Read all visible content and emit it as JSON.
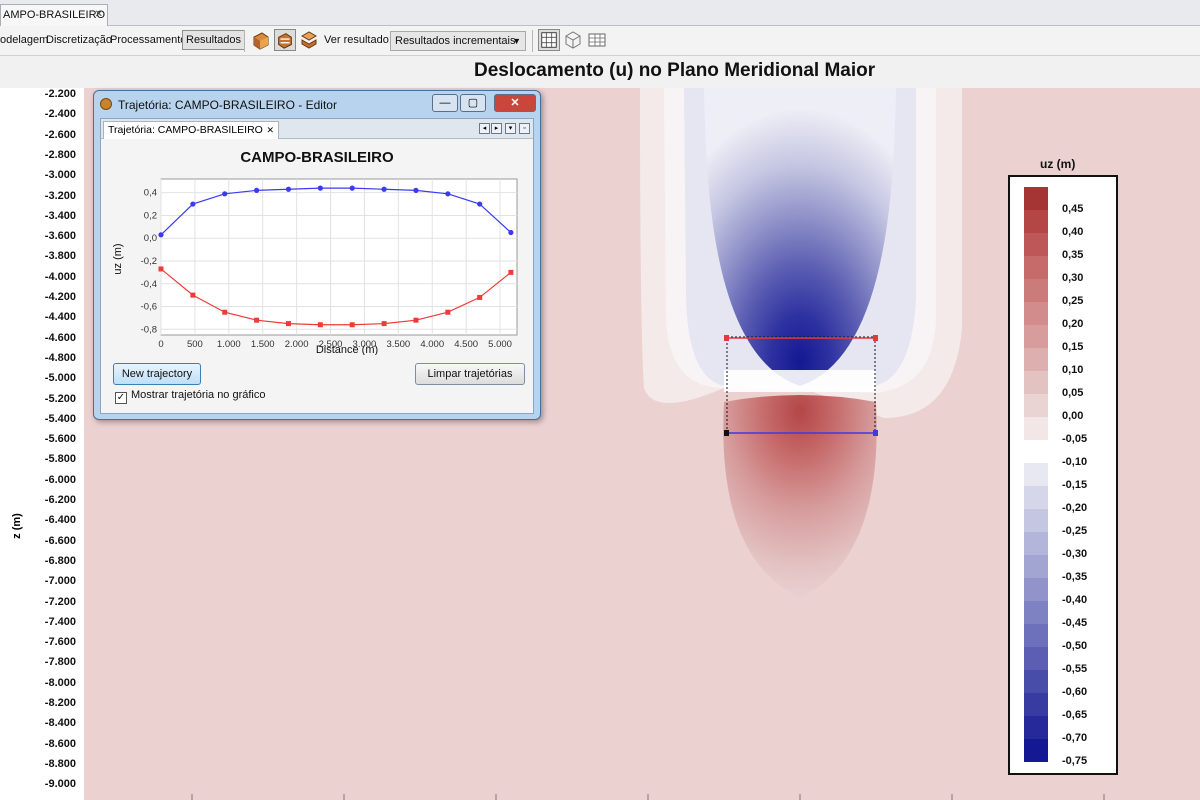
{
  "tab": {
    "label": "AMPO-BRASILEIRO"
  },
  "toolbar": {
    "modelagem": "odelagem",
    "discretizacao": "Discretização",
    "processamento": "Processamento",
    "resultados": "Resultados",
    "ver_resultado_label": "Ver resultado:",
    "ver_resultado_value": "Resultados incrementais"
  },
  "plot": {
    "title": "Deslocamento (u) no Plano Meridional Maior",
    "y_axis_label": "z (m)",
    "y_ticks": [
      "-2.200",
      "-2.400",
      "-2.600",
      "-2.800",
      "-3.000",
      "-3.200",
      "-3.400",
      "-3.600",
      "-3.800",
      "-4.000",
      "-4.200",
      "-4.400",
      "-4.600",
      "-4.800",
      "-5.000",
      "-5.200",
      "-5.400",
      "-5.600",
      "-5.800",
      "-6.000",
      "-6.200",
      "-6.400",
      "-6.600",
      "-6.800",
      "-7.000",
      "-7.200",
      "-7.400",
      "-7.600",
      "-7.800",
      "-8.000",
      "-8.200",
      "-8.400",
      "-8.600",
      "-8.800",
      "-9.000"
    ]
  },
  "colorbar": {
    "title": "uz (m)",
    "labels": [
      "0,45",
      "0,40",
      "0,35",
      "0,30",
      "0,25",
      "0,20",
      "0,15",
      "0,10",
      "0,05",
      "0,00",
      "-0,05",
      "-0,10",
      "-0,15",
      "-0,20",
      "-0,25",
      "-0,30",
      "-0,35",
      "-0,40",
      "-0,45",
      "-0,50",
      "-0,55",
      "-0,60",
      "-0,65",
      "-0,70",
      "-0,75"
    ],
    "colors": [
      "#a53535",
      "#b44646",
      "#be5858",
      "#c66a6a",
      "#cc7b7b",
      "#d28c8c",
      "#d79d9d",
      "#ddafaf",
      "#e3c2c2",
      "#e9d3d3",
      "#f2e6e6",
      "#ffffff",
      "#e8e8f2",
      "#d6d6ea",
      "#c5c6e2",
      "#b4b5da",
      "#a2a4d2",
      "#9193ca",
      "#7f82c2",
      "#6d70ba",
      "#5b5eb2",
      "#494daa",
      "#373ba2",
      "#25299a",
      "#141892"
    ]
  },
  "editor": {
    "window_title": "Trajetória: CAMPO-BRASILEIRO - Editor",
    "tab_label": "Trajetória: CAMPO-BRASILEIRO",
    "new_trajectory": "New trajectory",
    "clear": "Limpar trajetórias",
    "show_checkbox": "Mostrar trajetória no gráfico",
    "show_checked": true
  },
  "chart_data": {
    "type": "line",
    "title": "CAMPO-BRASILEIRO",
    "xlabel": "Distance (m)",
    "ylabel": "uz (m)",
    "xlim": [
      0,
      5250
    ],
    "ylim": [
      -0.85,
      0.52
    ],
    "x_ticks": [
      0,
      500,
      1000,
      1500,
      2000,
      2500,
      3000,
      3500,
      4000,
      4500,
      5000
    ],
    "x_tick_labels": [
      "0",
      "500",
      "1.000",
      "1.500",
      "2.000",
      "2.500",
      "3.000",
      "3.500",
      "4.000",
      "4.500",
      "5.000"
    ],
    "y_ticks": [
      0.4,
      0.2,
      0.0,
      -0.2,
      -0.4,
      -0.6,
      -0.8
    ],
    "y_tick_labels": [
      "0,4",
      "0,2",
      "0,0",
      "-0,2",
      "-0,4",
      "-0,6",
      "-0,8"
    ],
    "series": [
      {
        "color": "#3a3af0",
        "x": [
          0,
          470,
          940,
          1410,
          1880,
          2350,
          2820,
          3290,
          3760,
          4230,
          4700,
          5160
        ],
        "y": [
          0.03,
          0.3,
          0.39,
          0.42,
          0.43,
          0.44,
          0.44,
          0.43,
          0.42,
          0.39,
          0.3,
          0.05
        ]
      },
      {
        "color": "#f03a3a",
        "x": [
          0,
          470,
          940,
          1410,
          1880,
          2350,
          2820,
          3290,
          3760,
          4230,
          4700,
          5160
        ],
        "y": [
          -0.27,
          -0.5,
          -0.65,
          -0.72,
          -0.75,
          -0.76,
          -0.76,
          -0.75,
          -0.72,
          -0.65,
          -0.52,
          -0.3
        ]
      }
    ]
  }
}
